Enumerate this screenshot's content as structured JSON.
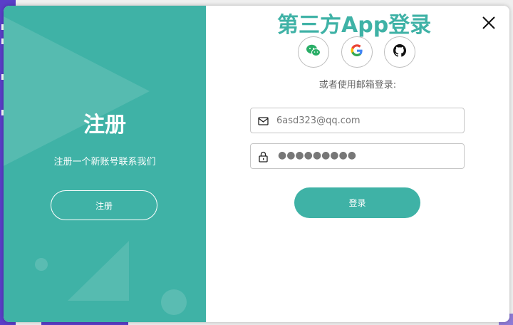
{
  "colors": {
    "accent": "#3fb2a6",
    "backdrop": "#5a3ec8"
  },
  "register_panel": {
    "title": "注册",
    "subtitle": "注册一个新账号联系我们",
    "button_label": "注册"
  },
  "login_panel": {
    "third_party_title": "第三方App登录",
    "social_icons": [
      "wechat-icon",
      "google-icon",
      "github-icon"
    ],
    "alt_text": "或者使用邮箱登录:",
    "email": {
      "value": "6asd323@qq.com"
    },
    "password": {
      "masked": "●●●●●●●●●"
    },
    "button_label": "登录"
  },
  "close_icon": "close-icon"
}
